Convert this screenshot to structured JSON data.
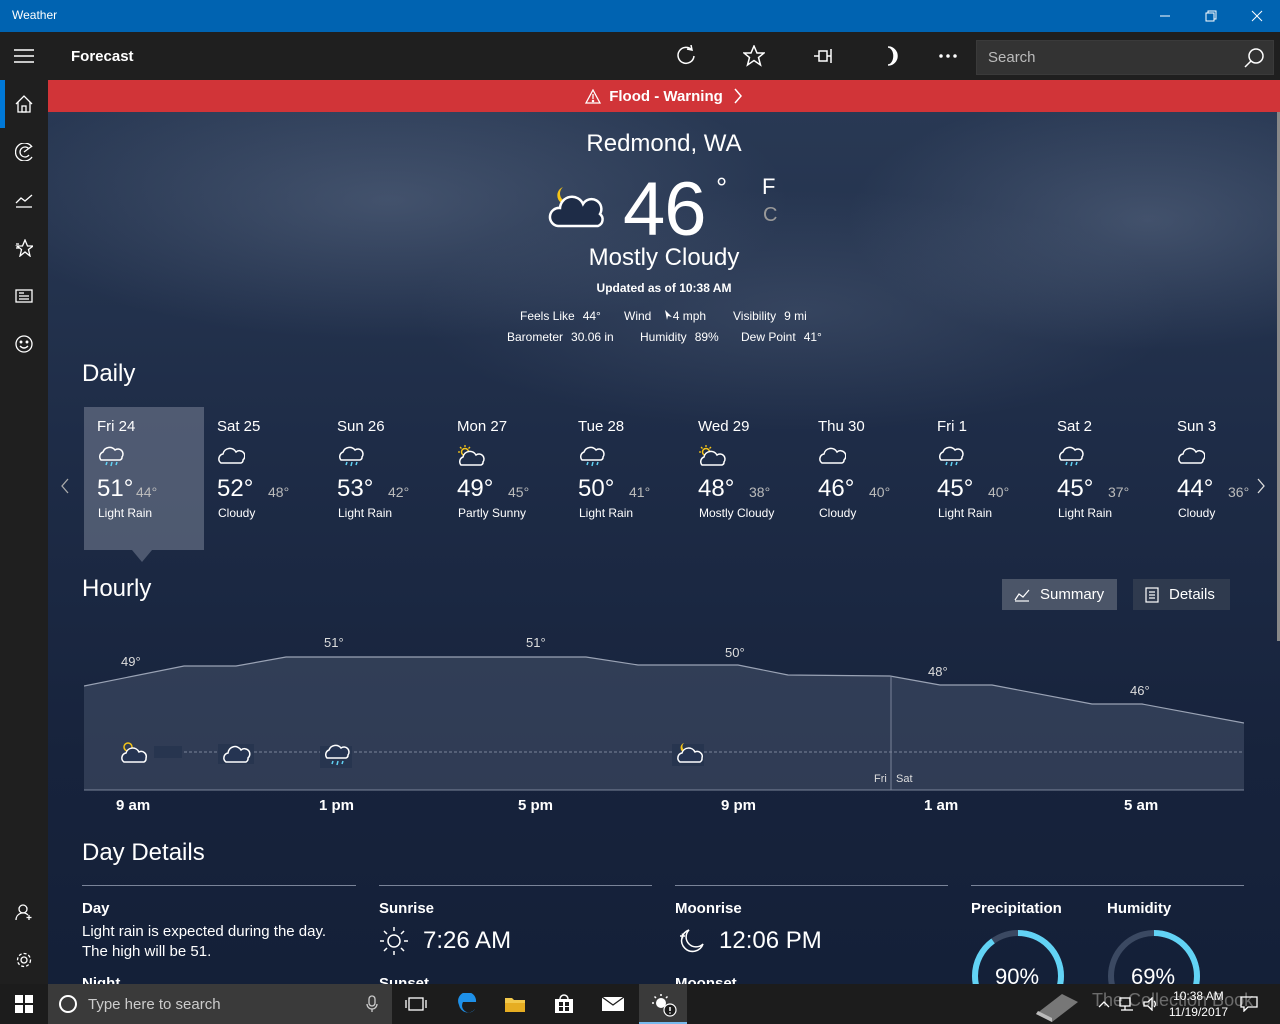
{
  "window": {
    "title": "Weather"
  },
  "appbar": {
    "heading": "Forecast",
    "search_placeholder": "Search"
  },
  "alert": {
    "text": "Flood - Warning"
  },
  "current": {
    "location": "Redmond, WA",
    "temperature": "46",
    "degree_symbol": "°",
    "unit_f": "F",
    "unit_c": "C",
    "condition": "Mostly Cloudy",
    "updated": "Updated as of 10:38 AM",
    "feels_like_label": "Feels Like",
    "feels_like": "44°",
    "wind_label": "Wind",
    "wind": "4 mph",
    "visibility_label": "Visibility",
    "visibility": "9 mi",
    "barometer_label": "Barometer",
    "barometer": "30.06 in",
    "humidity_label": "Humidity",
    "humidity": "89%",
    "dew_point_label": "Dew Point",
    "dew_point": "41°",
    "icon": "cloud-moon-icon"
  },
  "daily": {
    "title": "Daily",
    "days": [
      {
        "name": "Fri 24",
        "hi": "51°",
        "lo": "44°",
        "cond": "Light Rain",
        "icon": "rain-icon"
      },
      {
        "name": "Sat 25",
        "hi": "52°",
        "lo": "48°",
        "cond": "Cloudy",
        "icon": "cloud-icon"
      },
      {
        "name": "Sun 26",
        "hi": "53°",
        "lo": "42°",
        "cond": "Light Rain",
        "icon": "rain-icon"
      },
      {
        "name": "Mon 27",
        "hi": "49°",
        "lo": "45°",
        "cond": "Partly Sunny",
        "icon": "partly-sunny-icon"
      },
      {
        "name": "Tue 28",
        "hi": "50°",
        "lo": "41°",
        "cond": "Light Rain",
        "icon": "rain-icon"
      },
      {
        "name": "Wed 29",
        "hi": "48°",
        "lo": "38°",
        "cond": "Mostly Cloudy",
        "icon": "partly-sunny-icon"
      },
      {
        "name": "Thu 30",
        "hi": "46°",
        "lo": "40°",
        "cond": "Cloudy",
        "icon": "cloud-icon"
      },
      {
        "name": "Fri 1",
        "hi": "45°",
        "lo": "40°",
        "cond": "Light Rain",
        "icon": "rain-icon"
      },
      {
        "name": "Sat 2",
        "hi": "45°",
        "lo": "37°",
        "cond": "Light Rain",
        "icon": "rain-icon"
      },
      {
        "name": "Sun 3",
        "hi": "44°",
        "lo": "36°",
        "cond": "Cloudy",
        "icon": "cloud-icon"
      }
    ]
  },
  "hourly": {
    "title": "Hourly",
    "summary_label": "Summary",
    "details_label": "Details",
    "hour_labels": [
      "9 am",
      "1 pm",
      "5 pm",
      "9 pm",
      "1 am",
      "5 am"
    ],
    "day_split": [
      "Fri",
      "Sat"
    ],
    "temps": [
      {
        "label": "49°"
      },
      {
        "label": "51°"
      },
      {
        "label": "51°"
      },
      {
        "label": "50°"
      },
      {
        "label": "48°"
      },
      {
        "label": "46°"
      }
    ],
    "icons": [
      "partly-sunny-icon",
      "cloud-icon",
      "rain-icon",
      "cloud-moon-icon"
    ]
  },
  "day_details": {
    "title": "Day Details",
    "day_label": "Day",
    "day_text_1": "Light rain is expected during the day.",
    "day_text_2": "The high will be 51.",
    "night_label": "Night",
    "sunrise_label": "Sunrise",
    "sunrise": "7:26 AM",
    "sunset_label": "Sunset",
    "moonrise_label": "Moonrise",
    "moonrise": "12:06 PM",
    "moonset_label": "Moonset",
    "precipitation_label": "Precipitation",
    "precipitation": "90%",
    "precipitation_fraction": 0.9,
    "humidity_label": "Humidity",
    "humidity": "69%",
    "humidity_fraction": 0.69
  },
  "taskbar": {
    "search_placeholder": "Type here to search",
    "time": "10:38 AM",
    "date": "11/19/2017",
    "watermark": "The Collection Book"
  },
  "colors": {
    "accent": "#0063b1",
    "alert": "#d13438",
    "ring": "#62d3f5",
    "sun": "#f5c518"
  }
}
